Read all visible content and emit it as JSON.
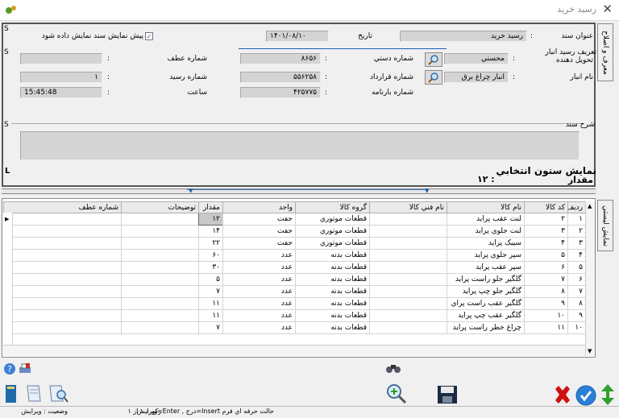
{
  "window": {
    "title": "رسيد خريد"
  },
  "header": {
    "preview_checkbox": "پيش نمايش سند نمايش داده شود",
    "date_label": "تاريخ",
    "date_value": "۱۴۰۱/۰۸/۱۰",
    "doc_title_label": "عنوان سند",
    "doc_title_value": "رسيد خريد",
    "def_label": "تعريف رسيد انبار",
    "deliverer_label": "تحويل دهنده",
    "deliverer_value": "محسني",
    "manual_no_label": "شماره دستي",
    "manual_no_value": "۸۶۵۶",
    "ref_no_label": "شماره عطف",
    "ref_no_value": "",
    "warehouse_label": "نام انبار",
    "warehouse_value": "انبار چراغ برق",
    "contract_label": "شماره قرارداد",
    "contract_value": "۵۵۶۲۵۸",
    "receipt_no_label": "شماره رسيد",
    "receipt_no_value": "۱",
    "waybill_label": "شماره بارنامه",
    "waybill_value": "۴۲۵۷۷۵",
    "time_label": "ساعت",
    "time_value": "15:45:48",
    "desc_label": "شرح سند",
    "side_tab": "معرف و اصلاح",
    "s_marker": "S",
    "l_marker": "L"
  },
  "selected_column": {
    "title": "نمايش ستون انتخابي",
    "name": "مقدار",
    "value": "۱۲ :"
  },
  "grid": {
    "side_tab": "نمايش ليستي",
    "columns": [
      "رديف",
      "کد کالا",
      "نام کالا",
      "نام فني کالا",
      "گروه کالا",
      "واحد",
      "مقدار",
      "توضيحات",
      "شماره عطف"
    ],
    "rows": [
      [
        "۱",
        "۲",
        "لنت عقب پرايد",
        "",
        "قطعات موتوري",
        "جفت",
        "۱۲",
        "",
        ""
      ],
      [
        "۲",
        "۳",
        "لنت جلوي پرايد",
        "",
        "قطعات موتوري",
        "جفت",
        "۱۴",
        "",
        ""
      ],
      [
        "۳",
        "۴",
        "سيبک پرايد",
        "",
        "قطعات موتوري",
        "جفت",
        "۲۲",
        "",
        ""
      ],
      [
        "۴",
        "۵",
        "سپر جلوي پرايد",
        "",
        "قطعات بدنه",
        "عدد",
        "۶۰",
        "",
        ""
      ],
      [
        "۵",
        "۶",
        "سپر عقب پرايد",
        "",
        "قطعات بدنه",
        "عدد",
        "۳۰",
        "",
        ""
      ],
      [
        "۶",
        "۷",
        "گلگير جلو راست پرايد",
        "",
        "قطعات بدنه",
        "عدد",
        "۵",
        "",
        ""
      ],
      [
        "۷",
        "۸",
        "گلگير جلو چپ پرايد",
        "",
        "قطعات بدنه",
        "عدد",
        "۷",
        "",
        ""
      ],
      [
        "۸",
        "۹",
        "گلگير عقب راست پراي",
        "",
        "قطعات بدنه",
        "عدد",
        "۱۱",
        "",
        ""
      ],
      [
        "۹",
        "۱۰",
        "گلگير عقب چپ پرايد",
        "",
        "قطعات بدنه",
        "عدد",
        "۱۱",
        "",
        ""
      ],
      [
        "۱۰",
        "۱۱",
        "چراغ خطر راست پرايد",
        "",
        "قطعات بدنه",
        "عدد",
        "۷",
        "",
        ""
      ]
    ]
  },
  "status": {
    "keys": "حالت حرفه اي فرم Insert=درج , Enter=ويرايش",
    "record": "رکورد ۱ از ۱",
    "state": "وضعيت : ويرايش"
  },
  "colors": {
    "accent": "#1a5fb4",
    "delete": "#d01010",
    "confirm": "#2a7fd8",
    "move": "#30a030"
  }
}
